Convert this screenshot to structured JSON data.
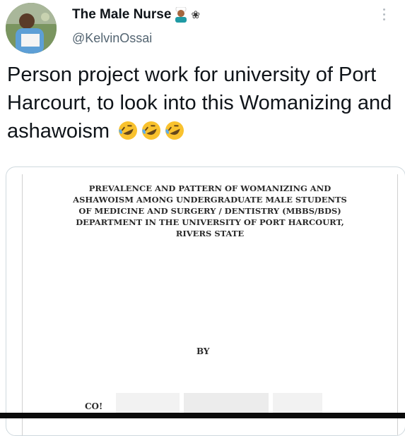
{
  "tweet": {
    "author_name": "The Male Nurse",
    "author_handle": "@KelvinOssai",
    "body_text": "Person project work for university of Port Harcourt, to look into this Womanizing and ashawoism",
    "icons": [
      "nurse-emoji-icon",
      "flower-icon",
      "more-options-icon",
      "rolling-laughing-emoji-icon"
    ]
  },
  "document": {
    "title": "PREVALENCE AND PATTERN OF WOMANIZING AND\nASHAWOISM AMONG UNDERGRADUATE MALE STUDENTS\nOF MEDICINE AND SURGERY / DENTISTRY (MBBS/BDS)\nDEPARTMENT IN THE UNIVERSITY OF PORT HARCOURT,\nRIVERS STATE",
    "by_label": "BY",
    "truncated_text": "CO!"
  },
  "colors": {
    "text": "#0f1419",
    "handle": "#536471",
    "card_border": "#cfd9de",
    "emoji_yellow": "#f9c22e"
  }
}
